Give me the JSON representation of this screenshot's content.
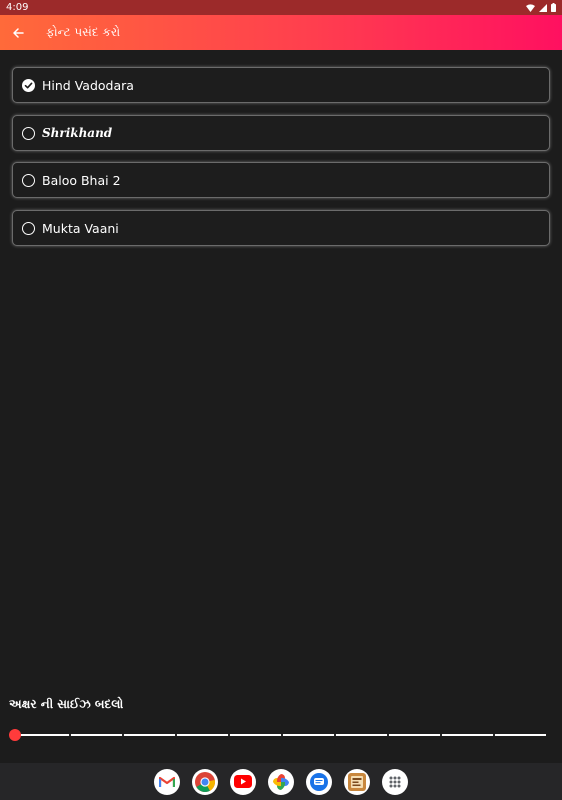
{
  "status_bar": {
    "time": "4:09"
  },
  "app_bar": {
    "title": "ફોન્ટ પસંદ કરો"
  },
  "fonts": [
    {
      "label": "Hind Vadodara",
      "selected": true
    },
    {
      "label": "Shrikhand",
      "selected": false
    },
    {
      "label": "Baloo Bhai 2",
      "selected": false
    },
    {
      "label": "Mukta Vaani",
      "selected": false
    }
  ],
  "size_section": {
    "label": "અક્ષર ની સાઈઝ બદલો",
    "slider_value": 0,
    "slider_steps": 10
  },
  "dock": {
    "apps": [
      "gmail-icon",
      "chrome-icon",
      "youtube-icon",
      "photos-icon",
      "messages-icon",
      "gallery-icon",
      "app-drawer-icon"
    ]
  },
  "colors": {
    "accent_start": "#ff6a3a",
    "accent_end": "#ff1060",
    "slider_thumb": "#ff3b3b",
    "background": "#1c1c1c"
  }
}
